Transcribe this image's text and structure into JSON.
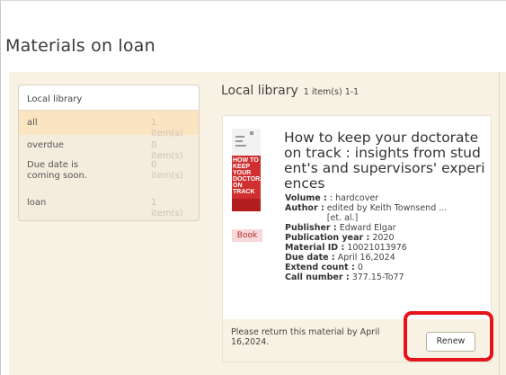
{
  "page": {
    "title": "Materials on loan"
  },
  "filter": {
    "header": "Local library",
    "items": [
      {
        "label": "all",
        "count": "1 item(s)"
      },
      {
        "label": "overdue",
        "count": "0 item(s)"
      },
      {
        "label": "Due date is coming soon.",
        "count": "0 item(s)"
      },
      {
        "label": "loan",
        "count": "1 item(s)"
      }
    ]
  },
  "results": {
    "title": "Local library",
    "count": "1 item(s) 1-1"
  },
  "item": {
    "title": "How to keep your doctorate on track : insights from student's and supervisors' experiences",
    "type_tag": "Book",
    "cover_text": "HOW TO KEEP YOUR DOCTORATE ON TRACK",
    "fields": [
      {
        "label": "Volume :",
        "value": ": hardcover"
      },
      {
        "label": "Author :",
        "value": "edited by Keith Townsend ... [et. al.]"
      },
      {
        "label": "Publisher :",
        "value": "Edward Elgar"
      },
      {
        "label": "Publication year :",
        "value": "2020"
      },
      {
        "label": "Material ID :",
        "value": "10021013976"
      },
      {
        "label": "Due date :",
        "value": "April 16,2024"
      },
      {
        "label": "Extend count :",
        "value": "0"
      },
      {
        "label": "Call number :",
        "value": "377.15-To77"
      }
    ],
    "notice": "Please return this material by April 16,2024.",
    "renew_label": "Renew"
  },
  "colors": {
    "highlight": "#e3141b",
    "active_filter_bg": "#fbe4c2",
    "content_bg": "#f7f2e3",
    "book_tag_bg": "#f7d7d7"
  }
}
